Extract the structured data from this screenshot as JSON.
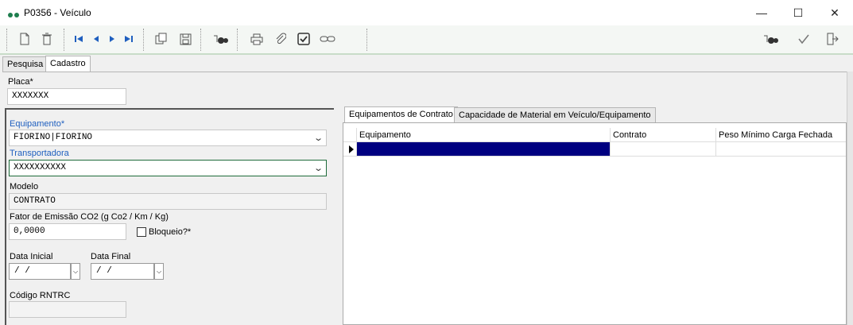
{
  "window": {
    "title": "P0356 - Veículo",
    "minimize": "—",
    "maximize": "☐",
    "close": "✕"
  },
  "toolbar": {
    "icons": [
      "new-doc-icon",
      "delete-icon",
      "first-icon",
      "prev-icon",
      "next-icon",
      "last-icon",
      "copy-icon",
      "save-icon",
      "search-icon",
      "print-icon",
      "attach-icon",
      "check-box-icon",
      "link-icon",
      "search-icon",
      "confirm-icon",
      "exit-icon"
    ]
  },
  "outer_tabs": [
    "Pesquisa",
    "Cadastro"
  ],
  "form": {
    "placa_label": "Placa*",
    "placa_value": "XXXXXXX",
    "equipamento_label": "Equipamento*",
    "equipamento_value": "FIORINO|FIORINO",
    "transportadora_label": "Transportadora",
    "transportadora_value": "XXXXXXXXXX",
    "modelo_label": "Modelo",
    "modelo_value": "CONTRATO",
    "fator_label": "Fator de Emissão CO2 (g Co2 / Km / Kg)",
    "fator_value": "0,0000",
    "bloqueio_label": "Bloqueio?*",
    "data_inicial_label": "Data Inicial",
    "data_inicial_value": " /  /",
    "data_final_label": "Data Final",
    "data_final_value": " /  /",
    "rntrc_label": "Código RNTRC",
    "rntrc_value": ""
  },
  "inner_tabs": [
    "Equipamentos de Contrato",
    "Capacidade de Material em Veículo/Equipamento"
  ],
  "grid": {
    "columns": [
      "Equipamento",
      "Contrato",
      "Peso Mínimo Carga Fechada"
    ]
  },
  "colors": {
    "accent": "#1e7e4e",
    "label_blue": "#1f5fbf",
    "selection": "#000080"
  }
}
